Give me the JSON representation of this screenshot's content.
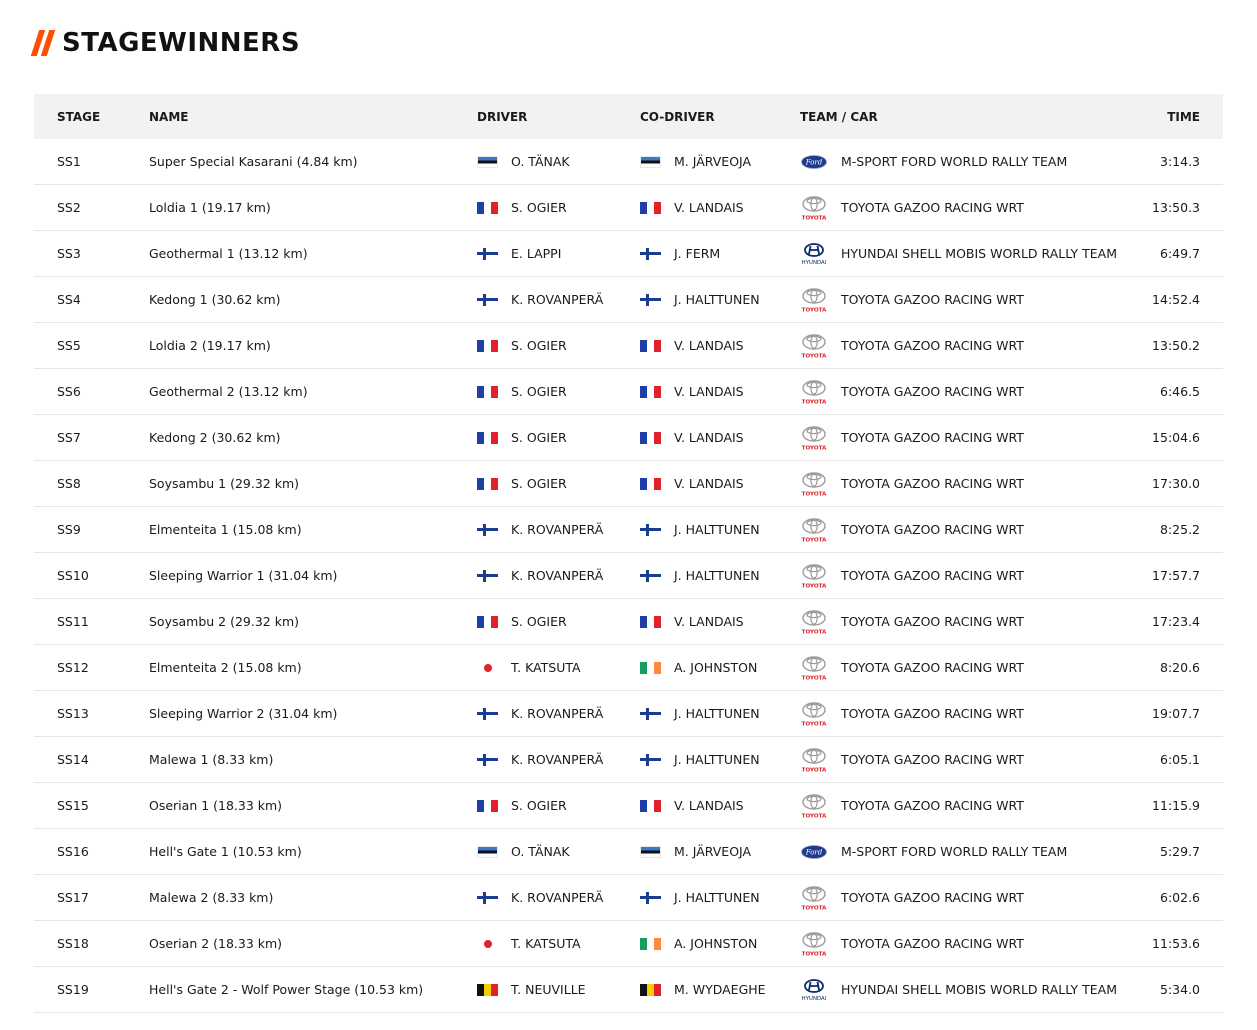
{
  "page": {
    "title": "STAGEWINNERS"
  },
  "headers": {
    "stage": "STAGE",
    "name": "NAME",
    "driver": "DRIVER",
    "codriver": "CO-DRIVER",
    "team": "TEAM / CAR",
    "time": "TIME"
  },
  "logos": {
    "toyota_text": "TOYOTA",
    "hyundai_text": "HYUNDAI",
    "ford_text": "Ford"
  },
  "rows": [
    {
      "stage": "SS1",
      "name": "Super Special Kasarani (4.84 km)",
      "driver": "O. TÄNAK",
      "driver_flag": "ee",
      "codriver": "M. JÄRVEOJA",
      "codriver_flag": "ee",
      "team": "M-SPORT FORD WORLD RALLY TEAM",
      "team_logo": "ford",
      "time": "3:14.3"
    },
    {
      "stage": "SS2",
      "name": "Loldia 1 (19.17 km)",
      "driver": "S. OGIER",
      "driver_flag": "fr",
      "codriver": "V. LANDAIS",
      "codriver_flag": "fr",
      "team": "TOYOTA GAZOO RACING WRT",
      "team_logo": "toyota",
      "time": "13:50.3"
    },
    {
      "stage": "SS3",
      "name": "Geothermal 1 (13.12 km)",
      "driver": "E. LAPPI",
      "driver_flag": "fi",
      "codriver": "J. FERM",
      "codriver_flag": "fi",
      "team": "HYUNDAI SHELL MOBIS WORLD RALLY TEAM",
      "team_logo": "hyundai",
      "time": "6:49.7"
    },
    {
      "stage": "SS4",
      "name": "Kedong 1 (30.62 km)",
      "driver": "K. ROVANPERÄ",
      "driver_flag": "fi",
      "codriver": "J. HALTTUNEN",
      "codriver_flag": "fi",
      "team": "TOYOTA GAZOO RACING WRT",
      "team_logo": "toyota",
      "time": "14:52.4"
    },
    {
      "stage": "SS5",
      "name": "Loldia 2 (19.17 km)",
      "driver": "S. OGIER",
      "driver_flag": "fr",
      "codriver": "V. LANDAIS",
      "codriver_flag": "fr",
      "team": "TOYOTA GAZOO RACING WRT",
      "team_logo": "toyota",
      "time": "13:50.2"
    },
    {
      "stage": "SS6",
      "name": "Geothermal 2 (13.12 km)",
      "driver": "S. OGIER",
      "driver_flag": "fr",
      "codriver": "V. LANDAIS",
      "codriver_flag": "fr",
      "team": "TOYOTA GAZOO RACING WRT",
      "team_logo": "toyota",
      "time": "6:46.5"
    },
    {
      "stage": "SS7",
      "name": "Kedong 2 (30.62 km)",
      "driver": "S. OGIER",
      "driver_flag": "fr",
      "codriver": "V. LANDAIS",
      "codriver_flag": "fr",
      "team": "TOYOTA GAZOO RACING WRT",
      "team_logo": "toyota",
      "time": "15:04.6"
    },
    {
      "stage": "SS8",
      "name": "Soysambu 1 (29.32 km)",
      "driver": "S. OGIER",
      "driver_flag": "fr",
      "codriver": "V. LANDAIS",
      "codriver_flag": "fr",
      "team": "TOYOTA GAZOO RACING WRT",
      "team_logo": "toyota",
      "time": "17:30.0"
    },
    {
      "stage": "SS9",
      "name": "Elmenteita 1 (15.08 km)",
      "driver": "K. ROVANPERÄ",
      "driver_flag": "fi",
      "codriver": "J. HALTTUNEN",
      "codriver_flag": "fi",
      "team": "TOYOTA GAZOO RACING WRT",
      "team_logo": "toyota",
      "time": "8:25.2"
    },
    {
      "stage": "SS10",
      "name": "Sleeping Warrior 1 (31.04 km)",
      "driver": "K. ROVANPERÄ",
      "driver_flag": "fi",
      "codriver": "J. HALTTUNEN",
      "codriver_flag": "fi",
      "team": "TOYOTA GAZOO RACING WRT",
      "team_logo": "toyota",
      "time": "17:57.7"
    },
    {
      "stage": "SS11",
      "name": "Soysambu 2 (29.32 km)",
      "driver": "S. OGIER",
      "driver_flag": "fr",
      "codriver": "V. LANDAIS",
      "codriver_flag": "fr",
      "team": "TOYOTA GAZOO RACING WRT",
      "team_logo": "toyota",
      "time": "17:23.4"
    },
    {
      "stage": "SS12",
      "name": "Elmenteita 2 (15.08 km)",
      "driver": "T. KATSUTA",
      "driver_flag": "jp",
      "codriver": "A. JOHNSTON",
      "codriver_flag": "ie",
      "team": "TOYOTA GAZOO RACING WRT",
      "team_logo": "toyota",
      "time": "8:20.6"
    },
    {
      "stage": "SS13",
      "name": "Sleeping Warrior 2 (31.04 km)",
      "driver": "K. ROVANPERÄ",
      "driver_flag": "fi",
      "codriver": "J. HALTTUNEN",
      "codriver_flag": "fi",
      "team": "TOYOTA GAZOO RACING WRT",
      "team_logo": "toyota",
      "time": "19:07.7"
    },
    {
      "stage": "SS14",
      "name": "Malewa 1 (8.33 km)",
      "driver": "K. ROVANPERÄ",
      "driver_flag": "fi",
      "codriver": "J. HALTTUNEN",
      "codriver_flag": "fi",
      "team": "TOYOTA GAZOO RACING WRT",
      "team_logo": "toyota",
      "time": "6:05.1"
    },
    {
      "stage": "SS15",
      "name": "Oserian 1 (18.33 km)",
      "driver": "S. OGIER",
      "driver_flag": "fr",
      "codriver": "V. LANDAIS",
      "codriver_flag": "fr",
      "team": "TOYOTA GAZOO RACING WRT",
      "team_logo": "toyota",
      "time": "11:15.9"
    },
    {
      "stage": "SS16",
      "name": "Hell's Gate 1 (10.53 km)",
      "driver": "O. TÄNAK",
      "driver_flag": "ee",
      "codriver": "M. JÄRVEOJA",
      "codriver_flag": "ee",
      "team": "M-SPORT FORD WORLD RALLY TEAM",
      "team_logo": "ford",
      "time": "5:29.7"
    },
    {
      "stage": "SS17",
      "name": "Malewa 2 (8.33 km)",
      "driver": "K. ROVANPERÄ",
      "driver_flag": "fi",
      "codriver": "J. HALTTUNEN",
      "codriver_flag": "fi",
      "team": "TOYOTA GAZOO RACING WRT",
      "team_logo": "toyota",
      "time": "6:02.6"
    },
    {
      "stage": "SS18",
      "name": "Oserian 2 (18.33 km)",
      "driver": "T. KATSUTA",
      "driver_flag": "jp",
      "codriver": "A. JOHNSTON",
      "codriver_flag": "ie",
      "team": "TOYOTA GAZOO RACING WRT",
      "team_logo": "toyota",
      "time": "11:53.6"
    },
    {
      "stage": "SS19",
      "name": "Hell's Gate 2 - Wolf Power Stage (10.53 km)",
      "driver": "T. NEUVILLE",
      "driver_flag": "be",
      "codriver": "M. WYDAEGHE",
      "codriver_flag": "be",
      "team": "HYUNDAI SHELL MOBIS WORLD RALLY TEAM",
      "team_logo": "hyundai",
      "time": "5:34.0"
    }
  ]
}
